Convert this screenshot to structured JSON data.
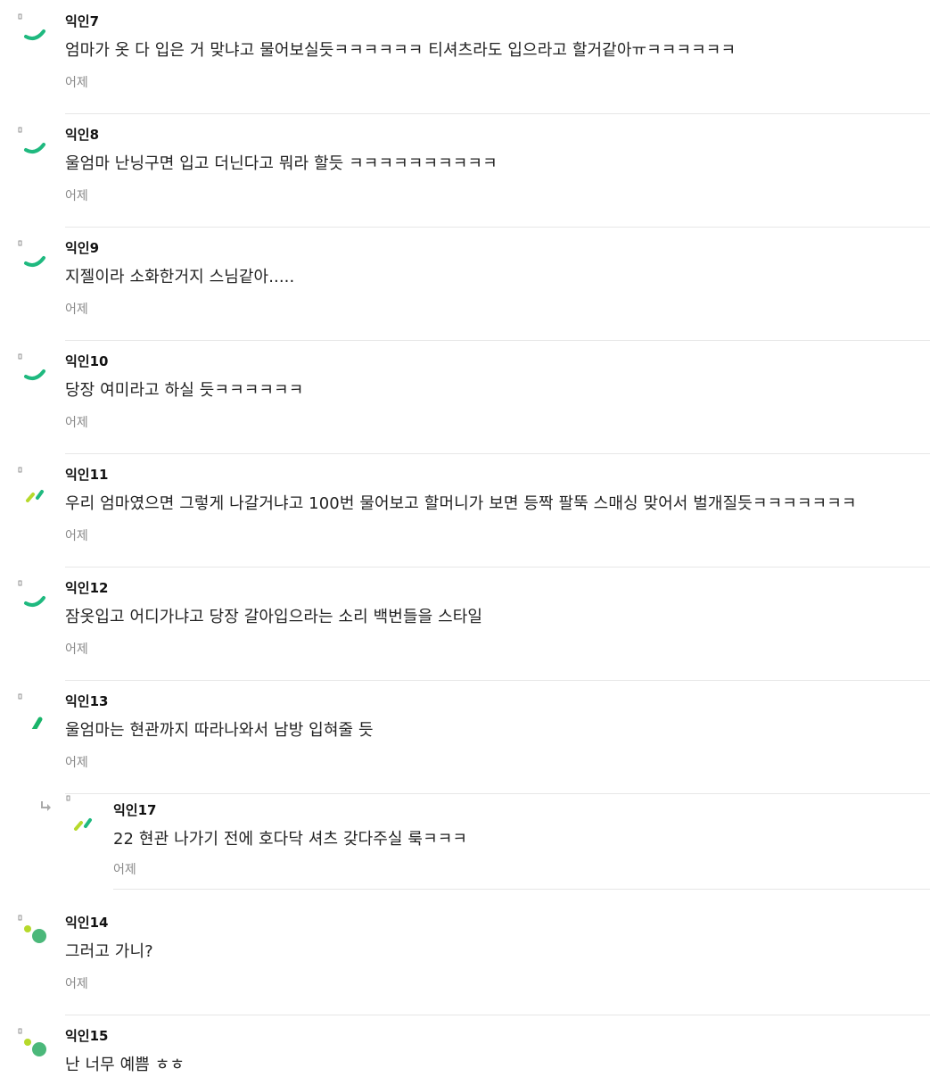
{
  "colors": {
    "green": "#1fb97f",
    "lime": "#b6d92b",
    "deep_green": "#19b46a",
    "dot_green": "#4bb87a",
    "separator": "#e6e6e6"
  },
  "comments": [
    {
      "author": "익인7",
      "text": "엄마가 옷 다 입은 거 맞냐고 물어보실듯ㅋㅋㅋㅋㅋㅋ 티셔츠라도 입으라고 할거같아ㅠㅋㅋㅋㅋㅋㅋ",
      "time": "어제",
      "avatar": "arc-icon"
    },
    {
      "author": "익인8",
      "text": "울엄마 난닝구면 입고 더닌다고 뭐라 할듯 ㅋㅋㅋㅋㅋㅋㅋㅋㅋㅋ",
      "time": "어제",
      "avatar": "arc-icon"
    },
    {
      "author": "익인9",
      "text": "지젤이라 소화한거지 스님같아.....",
      "time": "어제",
      "avatar": "arc-icon"
    },
    {
      "author": "익인10",
      "text": "당장 여미라고 하실 듯ㅋㅋㅋㅋㅋㅋ",
      "time": "어제",
      "avatar": "arc-icon"
    },
    {
      "author": "익인11",
      "text": "우리 엄마였으면 그렇게 나갈거냐고 100번 물어보고 할머니가 보면 등짝 팔뚝 스매싱 맞어서 벌개질듯ㅋㅋㅋㅋㅋㅋㅋ",
      "time": "어제",
      "avatar": "dash-icon"
    },
    {
      "author": "익인12",
      "text": "잠옷입고 어디가냐고 당장 갈아입으라는 소리 백번들을 스타일",
      "time": "어제",
      "avatar": "arc-icon"
    },
    {
      "author": "익인13",
      "text": "울엄마는 현관까지 따라나와서 남방 입혀줄 듯",
      "time": "어제",
      "avatar": "slash-icon"
    },
    {
      "author": "익인17",
      "text": "22 현관 나가기 전에 호다닥 셔츠 갖다주실 룩ㅋㅋㅋ",
      "time": "어제",
      "avatar": "dash-icon",
      "reply": true
    },
    {
      "author": "익인14",
      "text": "그러고 가니?",
      "time": "어제",
      "avatar": "dots-icon"
    },
    {
      "author": "익인15",
      "text": "난 너무 예쁨 ㅎㅎ",
      "time": "",
      "avatar": "dots-icon"
    }
  ]
}
